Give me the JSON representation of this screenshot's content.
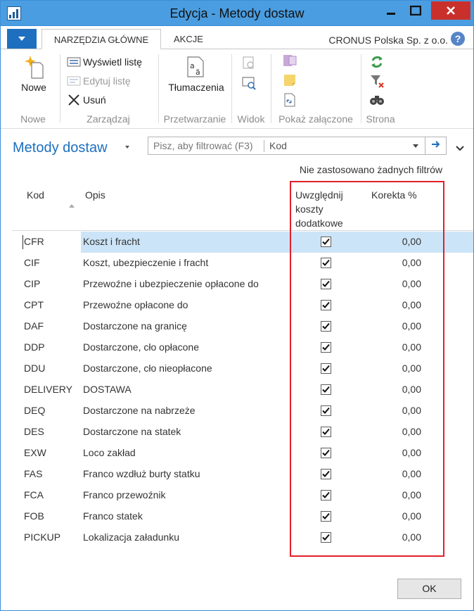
{
  "window": {
    "title": "Edycja - Metody dostaw",
    "app_icon": "nav-app-icon"
  },
  "ribbon_tabs": {
    "file_menu_icon": "dropdown-caret-icon",
    "active": "NARZĘDZIA GŁÓWNE",
    "other": "AKCJE",
    "company": "CRONUS Polska Sp. z o.o.",
    "help": "?"
  },
  "ribbon": {
    "nowe_group": {
      "label": "Nowe",
      "new_button": "Nowe"
    },
    "zarzadzaj_group": {
      "label": "Zarządzaj",
      "view_list": "Wyświetl listę",
      "edit_list": "Edytuj listę",
      "delete": "Usuń"
    },
    "przetwarzanie_group": {
      "label": "Przetwarzanie",
      "translations": "Tłumaczenia"
    },
    "widok_group": {
      "label": "Widok"
    },
    "zalaczone_group": {
      "label": "Pokaż załączone"
    },
    "strona_group": {
      "label": "Strona"
    }
  },
  "page": {
    "title": "Metody dostaw",
    "filter_placeholder": "Pisz, aby filtrować (F3)",
    "filter_field": "Kod",
    "filter_status": "Nie zastosowano żadnych filtrów"
  },
  "grid": {
    "columns": {
      "code": "Kod",
      "description": "Opis",
      "include_costs_line1": "Uwzględnij",
      "include_costs_line2": "koszty",
      "include_costs_line3": "dodatkowe",
      "adjustment": "Korekta %"
    },
    "rows": [
      {
        "code": "CFR",
        "description": "Koszt i fracht",
        "include_costs": true,
        "adjustment": "0,00"
      },
      {
        "code": "CIF",
        "description": "Koszt, ubezpieczenie i fracht",
        "include_costs": true,
        "adjustment": "0,00"
      },
      {
        "code": "CIP",
        "description": "Przewoźne i ubezpieczenie opłacone do",
        "include_costs": true,
        "adjustment": "0,00"
      },
      {
        "code": "CPT",
        "description": "Przewoźne opłacone do",
        "include_costs": true,
        "adjustment": "0,00"
      },
      {
        "code": "DAF",
        "description": "Dostarczone na granicę",
        "include_costs": true,
        "adjustment": "0,00"
      },
      {
        "code": "DDP",
        "description": "Dostarczone, cło opłacone",
        "include_costs": true,
        "adjustment": "0,00"
      },
      {
        "code": "DDU",
        "description": "Dostarczone, cło nieopłacone",
        "include_costs": true,
        "adjustment": "0,00"
      },
      {
        "code": "DELIVERY",
        "description": "DOSTAWA",
        "include_costs": true,
        "adjustment": "0,00"
      },
      {
        "code": "DEQ",
        "description": "Dostarczone na nabrzeże",
        "include_costs": true,
        "adjustment": "0,00"
      },
      {
        "code": "DES",
        "description": "Dostarczone na statek",
        "include_costs": true,
        "adjustment": "0,00"
      },
      {
        "code": "EXW",
        "description": "Loco zakład",
        "include_costs": true,
        "adjustment": "0,00"
      },
      {
        "code": "FAS",
        "description": "Franco wzdłuż burty statku",
        "include_costs": true,
        "adjustment": "0,00"
      },
      {
        "code": "FCA",
        "description": "Franco przewoźnik",
        "include_costs": true,
        "adjustment": "0,00"
      },
      {
        "code": "FOB",
        "description": "Franco statek",
        "include_costs": true,
        "adjustment": "0,00"
      },
      {
        "code": "PICKUP",
        "description": "Lokalizacja załadunku",
        "include_costs": true,
        "adjustment": "0,00"
      }
    ]
  },
  "footer": {
    "ok": "OK"
  },
  "colors": {
    "titlebar": "#4a9de0",
    "accent": "#1e6fbf",
    "close": "#c9302c",
    "selection": "#cce4f7",
    "highlight_border": "#e0202a"
  }
}
